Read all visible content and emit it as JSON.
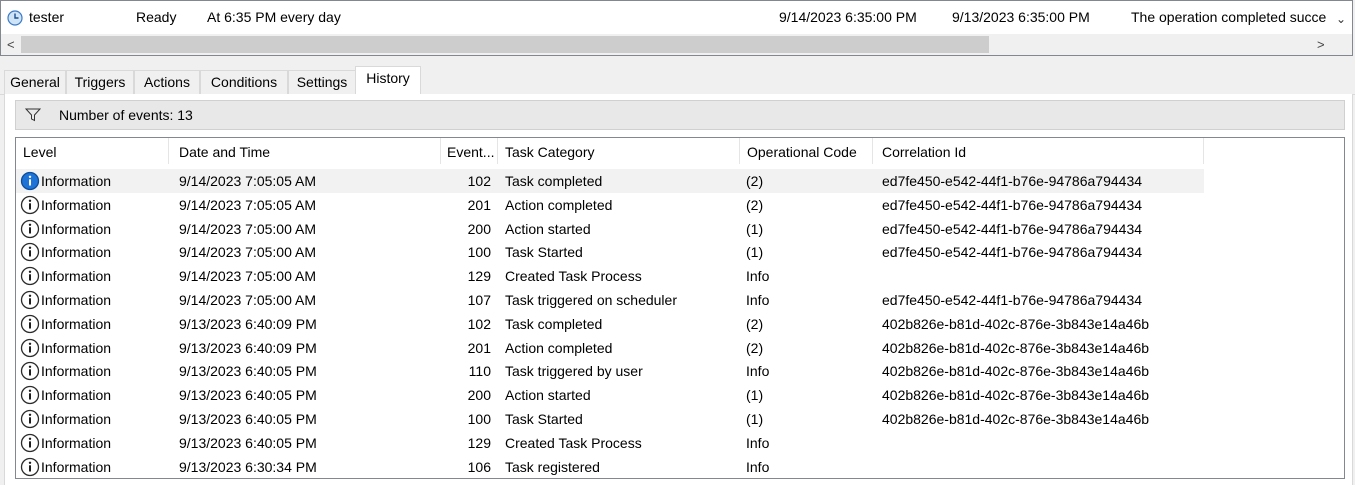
{
  "task": {
    "name": "tester",
    "status": "Ready",
    "trigger": "At 6:35 PM every day",
    "next_run": "9/14/2023 6:35:00 PM",
    "last_run": "9/13/2023 6:35:00 PM",
    "last_result": "The operation completed succe"
  },
  "scroll": {
    "left_arrow": "<",
    "right_arrow": ">",
    "down_arrow": "⌄"
  },
  "tabs": [
    "General",
    "Triggers",
    "Actions",
    "Conditions",
    "Settings",
    "History"
  ],
  "history": {
    "event_count_text": "Number of events: 13",
    "columns": {
      "level": "Level",
      "datetime": "Date and Time",
      "event": "Event...",
      "category": "Task Category",
      "opcode": "Operational Code",
      "correlation": "Correlation Id"
    },
    "rows": [
      {
        "level": "Information",
        "datetime": "9/14/2023 7:05:05 AM",
        "event": "102",
        "category": "Task completed",
        "opcode": "(2)",
        "correlation": "ed7fe450-e542-44f1-b76e-94786a794434"
      },
      {
        "level": "Information",
        "datetime": "9/14/2023 7:05:05 AM",
        "event": "201",
        "category": "Action completed",
        "opcode": "(2)",
        "correlation": "ed7fe450-e542-44f1-b76e-94786a794434"
      },
      {
        "level": "Information",
        "datetime": "9/14/2023 7:05:00 AM",
        "event": "200",
        "category": "Action started",
        "opcode": "(1)",
        "correlation": "ed7fe450-e542-44f1-b76e-94786a794434"
      },
      {
        "level": "Information",
        "datetime": "9/14/2023 7:05:00 AM",
        "event": "100",
        "category": "Task Started",
        "opcode": "(1)",
        "correlation": "ed7fe450-e542-44f1-b76e-94786a794434"
      },
      {
        "level": "Information",
        "datetime": "9/14/2023 7:05:00 AM",
        "event": "129",
        "category": "Created Task Process",
        "opcode": "Info",
        "correlation": ""
      },
      {
        "level": "Information",
        "datetime": "9/14/2023 7:05:00 AM",
        "event": "107",
        "category": "Task triggered on scheduler",
        "opcode": "Info",
        "correlation": "ed7fe450-e542-44f1-b76e-94786a794434"
      },
      {
        "level": "Information",
        "datetime": "9/13/2023 6:40:09 PM",
        "event": "102",
        "category": "Task completed",
        "opcode": "(2)",
        "correlation": "402b826e-b81d-402c-876e-3b843e14a46b"
      },
      {
        "level": "Information",
        "datetime": "9/13/2023 6:40:09 PM",
        "event": "201",
        "category": "Action completed",
        "opcode": "(2)",
        "correlation": "402b826e-b81d-402c-876e-3b843e14a46b"
      },
      {
        "level": "Information",
        "datetime": "9/13/2023 6:40:05 PM",
        "event": "110",
        "category": "Task triggered by user",
        "opcode": "Info",
        "correlation": "402b826e-b81d-402c-876e-3b843e14a46b"
      },
      {
        "level": "Information",
        "datetime": "9/13/2023 6:40:05 PM",
        "event": "200",
        "category": "Action started",
        "opcode": "(1)",
        "correlation": "402b826e-b81d-402c-876e-3b843e14a46b"
      },
      {
        "level": "Information",
        "datetime": "9/13/2023 6:40:05 PM",
        "event": "100",
        "category": "Task Started",
        "opcode": "(1)",
        "correlation": "402b826e-b81d-402c-876e-3b843e14a46b"
      },
      {
        "level": "Information",
        "datetime": "9/13/2023 6:40:05 PM",
        "event": "129",
        "category": "Created Task Process",
        "opcode": "Info",
        "correlation": ""
      },
      {
        "level": "Information",
        "datetime": "9/13/2023 6:30:34 PM",
        "event": "106",
        "category": "Task registered",
        "opcode": "Info",
        "correlation": ""
      }
    ]
  },
  "colors": {
    "info_icon": "#1e73d7",
    "selected_row": "#f2f2f2",
    "scroll_thumb": "#cdcdcd"
  },
  "icons": {
    "task": "clock-icon",
    "filter": "filter-icon",
    "level": "info-icon"
  }
}
